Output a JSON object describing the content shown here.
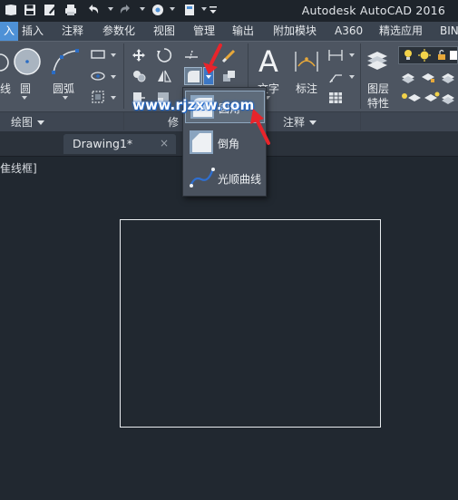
{
  "window": {
    "title": "Autodesk AutoCAD 2016"
  },
  "ribbon_tabs": [
    "入",
    "插入",
    "注释",
    "参数化",
    "视图",
    "管理",
    "输出",
    "附加模块",
    "A360",
    "精选应用",
    "BIN"
  ],
  "draw_panel": {
    "line_label": "线",
    "circle_label": "圆",
    "arc_label": "圆弧",
    "panel_title": "绘图"
  },
  "modify_panel": {
    "panel_title": "修"
  },
  "annotation_panel": {
    "text_label": "文字",
    "dim_label": "标注",
    "panel_title": "注释"
  },
  "layers_panel": {
    "label_line1": "图层",
    "label_line2": "特性"
  },
  "document": {
    "tab_label": "Drawing1*",
    "tab_close": "×",
    "viewport_label": "隹线框]"
  },
  "flyout": {
    "items": [
      {
        "label": "圆角",
        "icon": "fillet-icon"
      },
      {
        "label": "倒角",
        "icon": "chamfer-icon"
      },
      {
        "label": "光顺曲线",
        "icon": "blend-curves-icon"
      }
    ]
  },
  "watermark": {
    "text": "www.rjzxw.com"
  },
  "colors": {
    "active_tab": "#4e91d6",
    "ribbon_bg": "#4d5561",
    "canvas_bg": "#212830",
    "arrow_red": "#e8242b"
  }
}
